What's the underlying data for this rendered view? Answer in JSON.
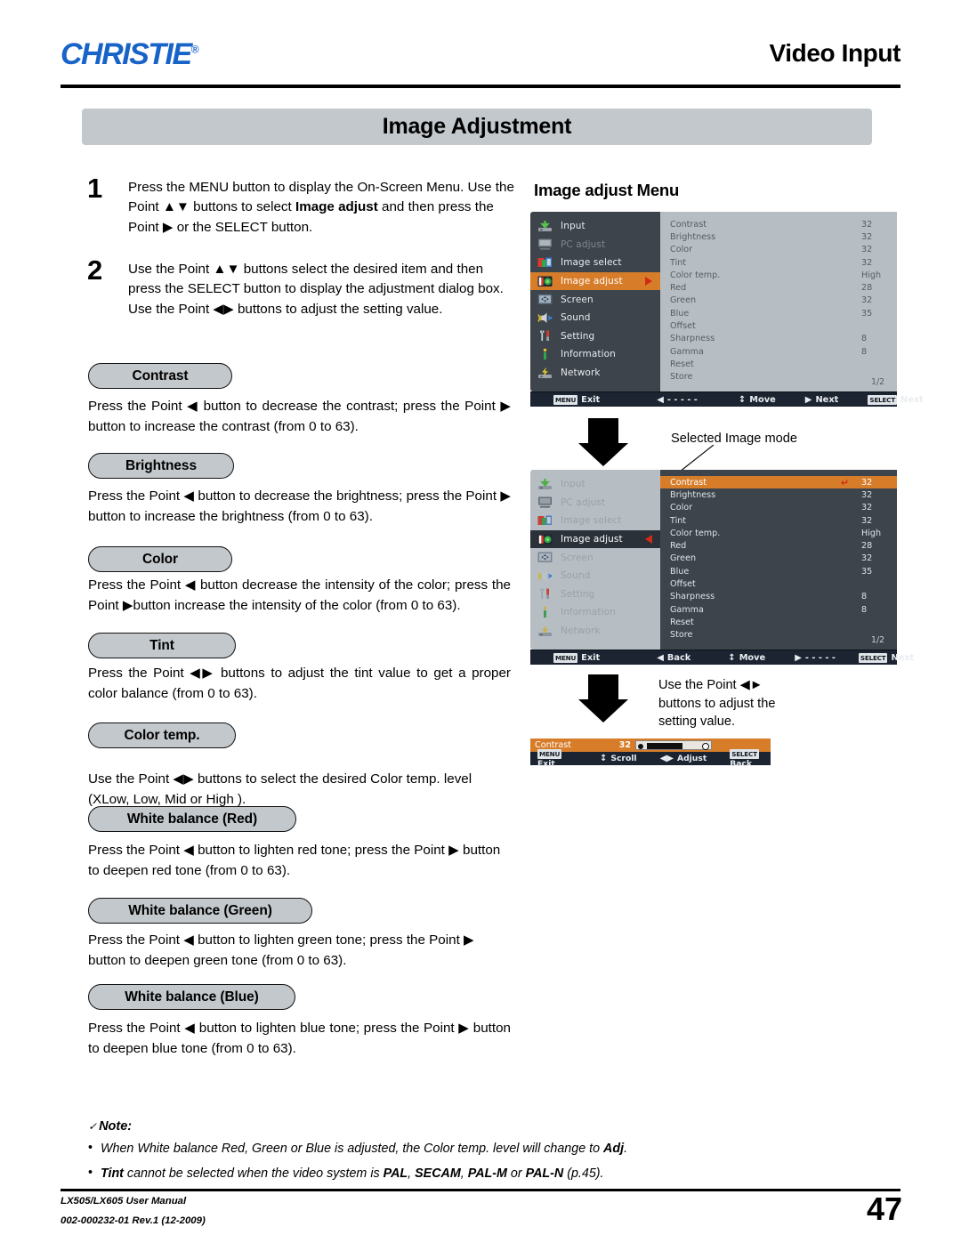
{
  "header": {
    "logo": "CHRISTIE",
    "logo_reg": "®",
    "section_title": "Video Input",
    "page_title": "Image Adjustment"
  },
  "steps": [
    {
      "num": "1",
      "text": "Press the MENU button to display the On-Screen Menu. Use the Point ▲▼ buttons to select Image adjust and then press the Point ▶ or the SELECT button."
    },
    {
      "num": "2",
      "text": "Use the Point ▲ ▼ buttons select the desired item and then press the SELECT button to display the adjustment dialog box. Use the Point ◀▶ buttons to adjust the setting value."
    }
  ],
  "sections": [
    {
      "heading": "Contrast",
      "text": "Press the Point ◀ button to decrease the contrast; press the Point ▶ button to increase the contrast (from 0 to 63)."
    },
    {
      "heading": "Brightness",
      "text": "Press the Point ◀ button to decrease the brightness; press  the Point ▶ button to increase the brightness (from 0 to 63)."
    },
    {
      "heading": "Color",
      "text": "Press the Point ◀ button decrease the intensity of the color; press the Point ▶button increase the intensity of the color (from 0 to 63)."
    },
    {
      "heading": "Tint",
      "text": "Press the Point ◀▶ buttons to adjust the tint value to get a proper color balance (from 0 to 63)."
    },
    {
      "heading": "Color temp.",
      "text": "Use the Point ◀▶ buttons to select the desired Color temp. level (XLow, Low, Mid or High )."
    },
    {
      "heading": "White balance (Red)",
      "text": "Press the Point ◀ button to lighten red tone; press the Point ▶ button to deepen red tone (from 0 to 63)."
    },
    {
      "heading": "White balance (Green)",
      "text": "Press the Point ◀ button to lighten green tone; press the Point ▶ button to deepen green tone (from 0 to 63)."
    },
    {
      "heading": "White balance (Blue)",
      "text": "Press the Point ◀ button to lighten blue tone; press the Point ▶ button to deepen blue tone (from 0 to 63)."
    }
  ],
  "right_panel": {
    "heading": "Image adjust Menu",
    "callout_selected_image_mode": "Selected Image mode",
    "callout_adjust": "Use the Point ◀▶ buttons to adjust the setting value."
  },
  "osd_menu_items": [
    {
      "label": "Input",
      "icon": "input-icon"
    },
    {
      "label": "PC adjust",
      "icon": "pc-adjust-icon"
    },
    {
      "label": "Image select",
      "icon": "image-select-icon"
    },
    {
      "label": "Image adjust",
      "icon": "image-adjust-icon"
    },
    {
      "label": "Screen",
      "icon": "screen-icon"
    },
    {
      "label": "Sound",
      "icon": "sound-icon"
    },
    {
      "label": "Setting",
      "icon": "setting-icon"
    },
    {
      "label": "Information",
      "icon": "information-icon"
    },
    {
      "label": "Network",
      "icon": "network-icon"
    }
  ],
  "osd_settings": [
    {
      "label": "Contrast",
      "value": "32"
    },
    {
      "label": "Brightness",
      "value": "32"
    },
    {
      "label": "Color",
      "value": "32"
    },
    {
      "label": "Tint",
      "value": "32"
    },
    {
      "label": "Color temp.",
      "value": "High"
    },
    {
      "label": "Red",
      "value": "28"
    },
    {
      "label": "Green",
      "value": "32"
    },
    {
      "label": "Blue",
      "value": "35"
    },
    {
      "label": "Offset",
      "value": ""
    },
    {
      "label": "Sharpness",
      "value": "8"
    },
    {
      "label": "Gamma",
      "value": "8"
    },
    {
      "label": "Reset",
      "value": ""
    },
    {
      "label": "Store",
      "value": ""
    }
  ],
  "osd1": {
    "page_indicator": "1/2",
    "bar": [
      {
        "key": "MENU",
        "label": "Exit"
      },
      {
        "glyph": "◀",
        "label": "- - - - -"
      },
      {
        "glyph": "↕",
        "label": "Move"
      },
      {
        "glyph": "▶",
        "label": "Next"
      },
      {
        "key": "SELECT",
        "label": "Next"
      }
    ]
  },
  "osd2": {
    "page_indicator": "1/2",
    "highlighted_item": "Contrast",
    "highlighted_value": "32",
    "bar": [
      {
        "key": "MENU",
        "label": "Exit"
      },
      {
        "glyph": "◀",
        "label": "Back"
      },
      {
        "glyph": "↕",
        "label": "Move"
      },
      {
        "glyph": "▶",
        "label": "- - - - -"
      },
      {
        "key": "SELECT",
        "label": "Next"
      }
    ]
  },
  "slider_dialog": {
    "label": "Contrast",
    "value": "32",
    "bar": [
      {
        "key": "MENU",
        "label": "Exit"
      },
      {
        "glyph": "↕",
        "label": "Scroll"
      },
      {
        "glyph": "◀▶",
        "label": "Adjust"
      },
      {
        "key": "SELECT",
        "label": "Back"
      }
    ]
  },
  "note": {
    "title": "Note:",
    "check": "✓",
    "items": [
      "When White balance Red, Green or Blue is adjusted, the Color temp. level will change to Adj.",
      "Tint cannot be selected when the video system is PAL, SECAM, PAL-M or PAL-N (p.45)."
    ]
  },
  "footer": {
    "manual": "LX505/LX605 User Manual",
    "doc_id": "002-000232-01 Rev.1 (12-2009)",
    "page_number": "47"
  },
  "colors": {
    "brand_blue": "#1763c8",
    "banner_gray": "#c3c8cc",
    "osd_dark": "#3d444c",
    "osd_light": "#b6bec4",
    "osd_orange": "#d77d2a",
    "osd_bar": "#1b2430",
    "arrow_red": "#cf2b16"
  }
}
